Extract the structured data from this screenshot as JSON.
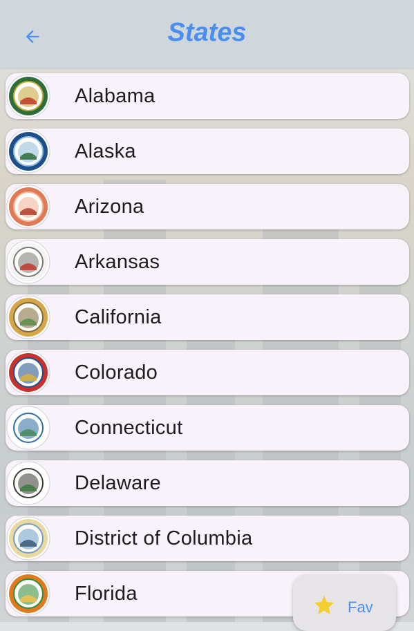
{
  "app_bar": {
    "title": "States",
    "back_icon": "arrow-left-icon"
  },
  "states": [
    {
      "name": "Alabama",
      "seal_colors": [
        "#2f6e3a",
        "#c8a83a",
        "#c23a2a"
      ]
    },
    {
      "name": "Alaska",
      "seal_colors": [
        "#1e4f8a",
        "#8fc0e0",
        "#2c6b3a"
      ]
    },
    {
      "name": "Arizona",
      "seal_colors": [
        "#e07a55",
        "#f2b59b",
        "#b33a2e"
      ]
    },
    {
      "name": "Arkansas",
      "seal_colors": [
        "#f3f3f3",
        "#7a7a7a",
        "#c23a2a"
      ]
    },
    {
      "name": "California",
      "seal_colors": [
        "#d7a64a",
        "#7d6b3a",
        "#5e8a4a"
      ]
    },
    {
      "name": "Colorado",
      "seal_colors": [
        "#c8322e",
        "#1f4f8f",
        "#d9b23a"
      ]
    },
    {
      "name": "Connecticut",
      "seal_colors": [
        "#ffffff",
        "#2c6fa6",
        "#4b8a5a"
      ]
    },
    {
      "name": "Delaware",
      "seal_colors": [
        "#ffffff",
        "#3a3a3a",
        "#3e7a3e"
      ]
    },
    {
      "name": "District of Columbia",
      "seal_colors": [
        "#e9d9a0",
        "#6ea0c8",
        "#3a5a7a"
      ]
    },
    {
      "name": "Florida",
      "seal_colors": [
        "#e07a1f",
        "#2f8a3a",
        "#f2c14a"
      ]
    }
  ],
  "fab": {
    "label": "Fav",
    "icon": "star-icon",
    "icon_color": "#f2cf2e"
  }
}
